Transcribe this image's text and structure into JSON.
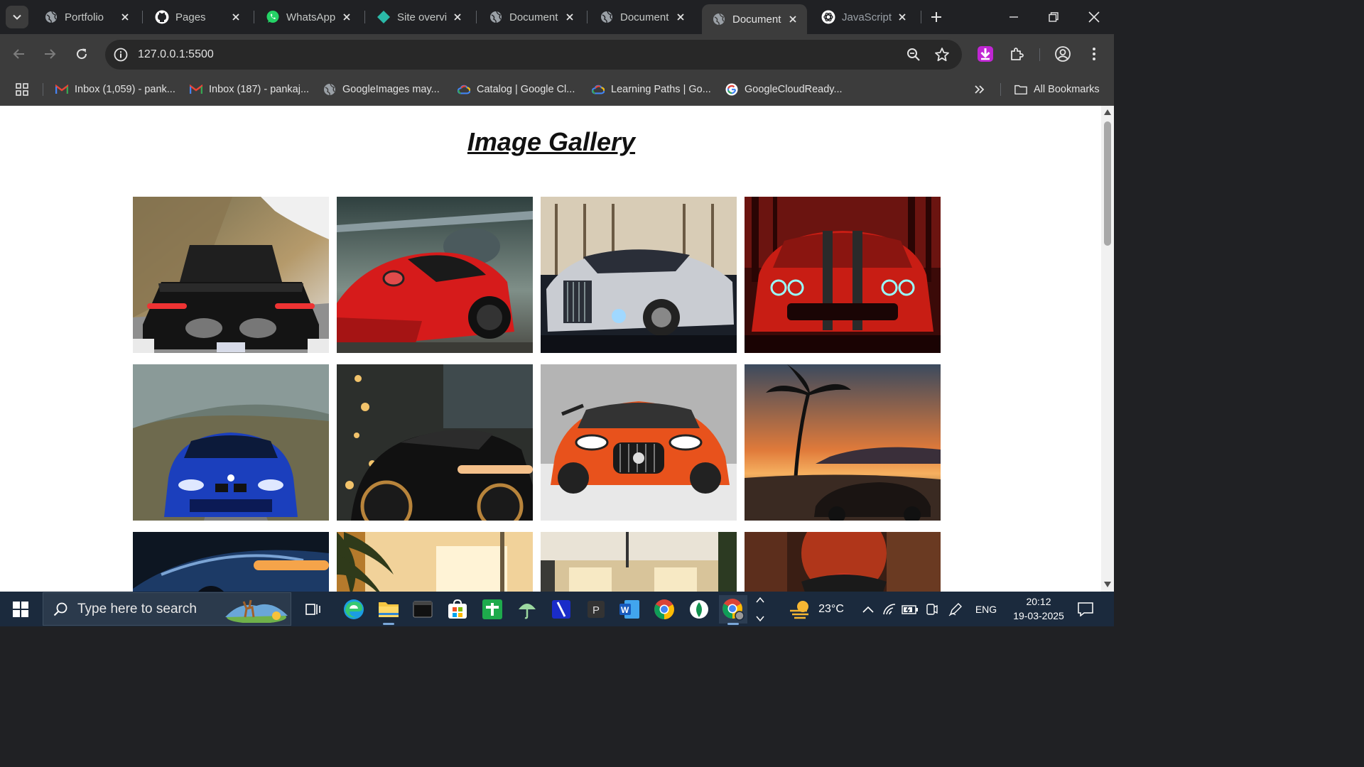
{
  "browser": {
    "tabs": [
      {
        "title": "Portfolio",
        "icon": "globe-icon",
        "active": false
      },
      {
        "title": "Pages",
        "icon": "github-icon",
        "active": false
      },
      {
        "title": "WhatsApp",
        "icon": "whatsapp-icon",
        "active": false
      },
      {
        "title": "Site overvi",
        "icon": "netlify-icon",
        "active": false
      },
      {
        "title": "Document",
        "icon": "globe-icon",
        "active": false
      },
      {
        "title": "Document",
        "icon": "globe-icon",
        "active": false
      },
      {
        "title": "Document",
        "icon": "globe-icon",
        "active": true
      },
      {
        "title": "JavaScript",
        "icon": "chatgpt-icon",
        "active": false
      }
    ],
    "address": "127.0.0.1:5500",
    "bookmarks": [
      {
        "label": "Inbox (1,059) - pank...",
        "icon": "gmail-icon"
      },
      {
        "label": "Inbox (187) - pankaj...",
        "icon": "gmail-icon"
      },
      {
        "label": "GoogleImages may...",
        "icon": "globe-icon"
      },
      {
        "label": "Catalog | Google Cl...",
        "icon": "google-cloud-icon"
      },
      {
        "label": "Learning Paths | Go...",
        "icon": "google-cloud-icon"
      },
      {
        "label": "GoogleCloudReady...",
        "icon": "google-icon"
      }
    ],
    "all_bookmarks": "All Bookmarks"
  },
  "page": {
    "title": "Image Gallery",
    "images": [
      {
        "name": "gallery-image-lamborghini-rear"
      },
      {
        "name": "gallery-image-red-ferrari"
      },
      {
        "name": "gallery-image-rolls-royce"
      },
      {
        "name": "gallery-image-red-challenger"
      },
      {
        "name": "gallery-image-blue-bmw"
      },
      {
        "name": "gallery-image-black-porsche"
      },
      {
        "name": "gallery-image-orange-amg"
      },
      {
        "name": "gallery-image-sunset-car"
      },
      {
        "name": "gallery-image-blue-car-detail"
      },
      {
        "name": "gallery-image-showroom-interior"
      },
      {
        "name": "gallery-image-shop-front"
      },
      {
        "name": "gallery-image-autumn-car"
      }
    ]
  },
  "taskbar": {
    "search_placeholder": "Type here to search",
    "weather": "23°C",
    "language": "ENG",
    "time": "20:12",
    "date": "19-03-2025"
  },
  "colors": {
    "chrome_dark": "#202124",
    "chrome_toolbar": "#3c3c3c",
    "taskbar": "#1b2a3d"
  }
}
